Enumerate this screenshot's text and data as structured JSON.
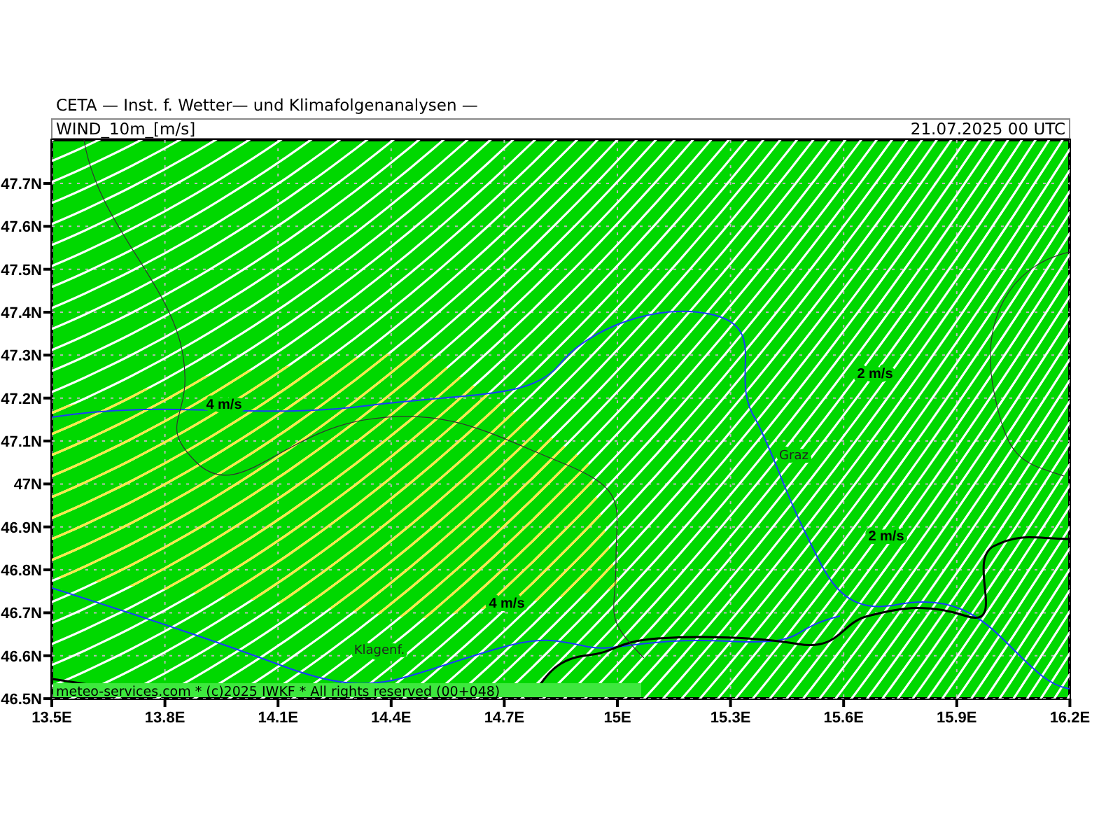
{
  "header": "CETA — Inst. f. Wetter— und Klimafolgenanalysen —",
  "panel": {
    "title": "WIND_10m_[m/s]",
    "date": "21.07.2025 00 UTC"
  },
  "map": {
    "labels": [
      {
        "kind": "speed",
        "text": "4 m/s"
      },
      {
        "kind": "speed",
        "text": "2 m/s"
      },
      {
        "kind": "city",
        "text": "Graz"
      },
      {
        "kind": "speed",
        "text": "2 m/s"
      },
      {
        "kind": "speed",
        "text": "4 m/s"
      },
      {
        "kind": "city",
        "text": "Klagenf."
      }
    ],
    "footer": "meteo-services.com * (c)2025 IWKF * All rights reserved (00+048)"
  },
  "y_axis": [
    "47.7N",
    "47.6N",
    "47.5N",
    "47.4N",
    "47.3N",
    "47.2N",
    "47.1N",
    "47N",
    "46.9N",
    "46.8N",
    "46.7N",
    "46.6N",
    "46.5N"
  ],
  "x_axis": [
    "13.5E",
    "13.8E",
    "14.1E",
    "14.4E",
    "14.7E",
    "15E",
    "15.3E",
    "15.6E",
    "15.9E",
    "16.2E"
  ]
}
